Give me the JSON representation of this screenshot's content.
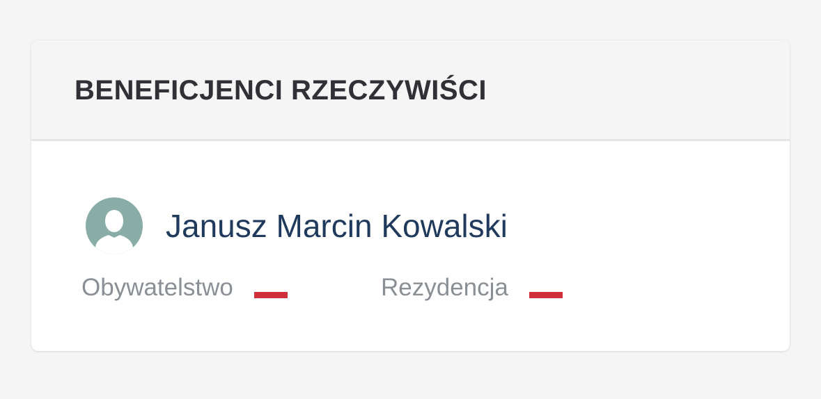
{
  "card": {
    "title": "BENEFICJENCI RZECZYWIŚCI"
  },
  "beneficiary": {
    "name": "Janusz Marcin Kowalski",
    "avatar_icon": "user-avatar-icon",
    "citizenship": {
      "label": "Obywatelstwo",
      "flag_icon": "poland-flag-icon",
      "flag_colors": [
        "#ffffff",
        "#d0303c"
      ]
    },
    "residence": {
      "label": "Rezydencja",
      "flag_icon": "poland-flag-icon",
      "flag_colors": [
        "#ffffff",
        "#d0303c"
      ]
    }
  },
  "colors": {
    "page_background": "#f5f5f6",
    "card_background": "#ffffff",
    "title": "#2f3136",
    "name": "#1f3a5c",
    "label": "#8a8f96",
    "avatar": "#89aca6"
  }
}
